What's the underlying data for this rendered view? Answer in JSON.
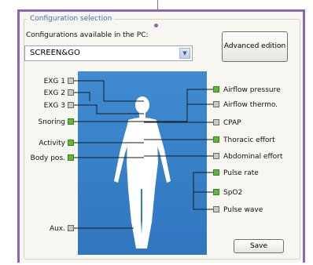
{
  "group_title": "Configuration selection",
  "configs_label": "Configurations available in the PC:",
  "selected_config": "SCREEN&GO",
  "advanced_button": "Advanced edition",
  "save_button": "Save",
  "left_sensors": [
    {
      "label": "EXG 1",
      "enabled": false
    },
    {
      "label": "EXG 2",
      "enabled": false
    },
    {
      "label": "EXG 3",
      "enabled": false
    },
    {
      "label": "Snoring",
      "enabled": true
    },
    {
      "label": "Activity",
      "enabled": true
    },
    {
      "label": "Body pos.",
      "enabled": true
    },
    {
      "label": "Aux.",
      "enabled": false
    }
  ],
  "right_sensors": [
    {
      "label": "Airflow pressure",
      "enabled": true
    },
    {
      "label": "Airflow thermo.",
      "enabled": false
    },
    {
      "label": "CPAP",
      "enabled": false
    },
    {
      "label": "Thoracic effort",
      "enabled": true
    },
    {
      "label": "Abdominal effort",
      "enabled": false
    },
    {
      "label": "Pulse rate",
      "enabled": true
    },
    {
      "label": "SpO2",
      "enabled": true
    },
    {
      "label": "Pulse wave",
      "enabled": false
    }
  ],
  "colors": {
    "accent": "#8a67b5",
    "enabled": "#5cb837",
    "disabled": "#c9c9c9",
    "panel": "#3f8bd1"
  }
}
